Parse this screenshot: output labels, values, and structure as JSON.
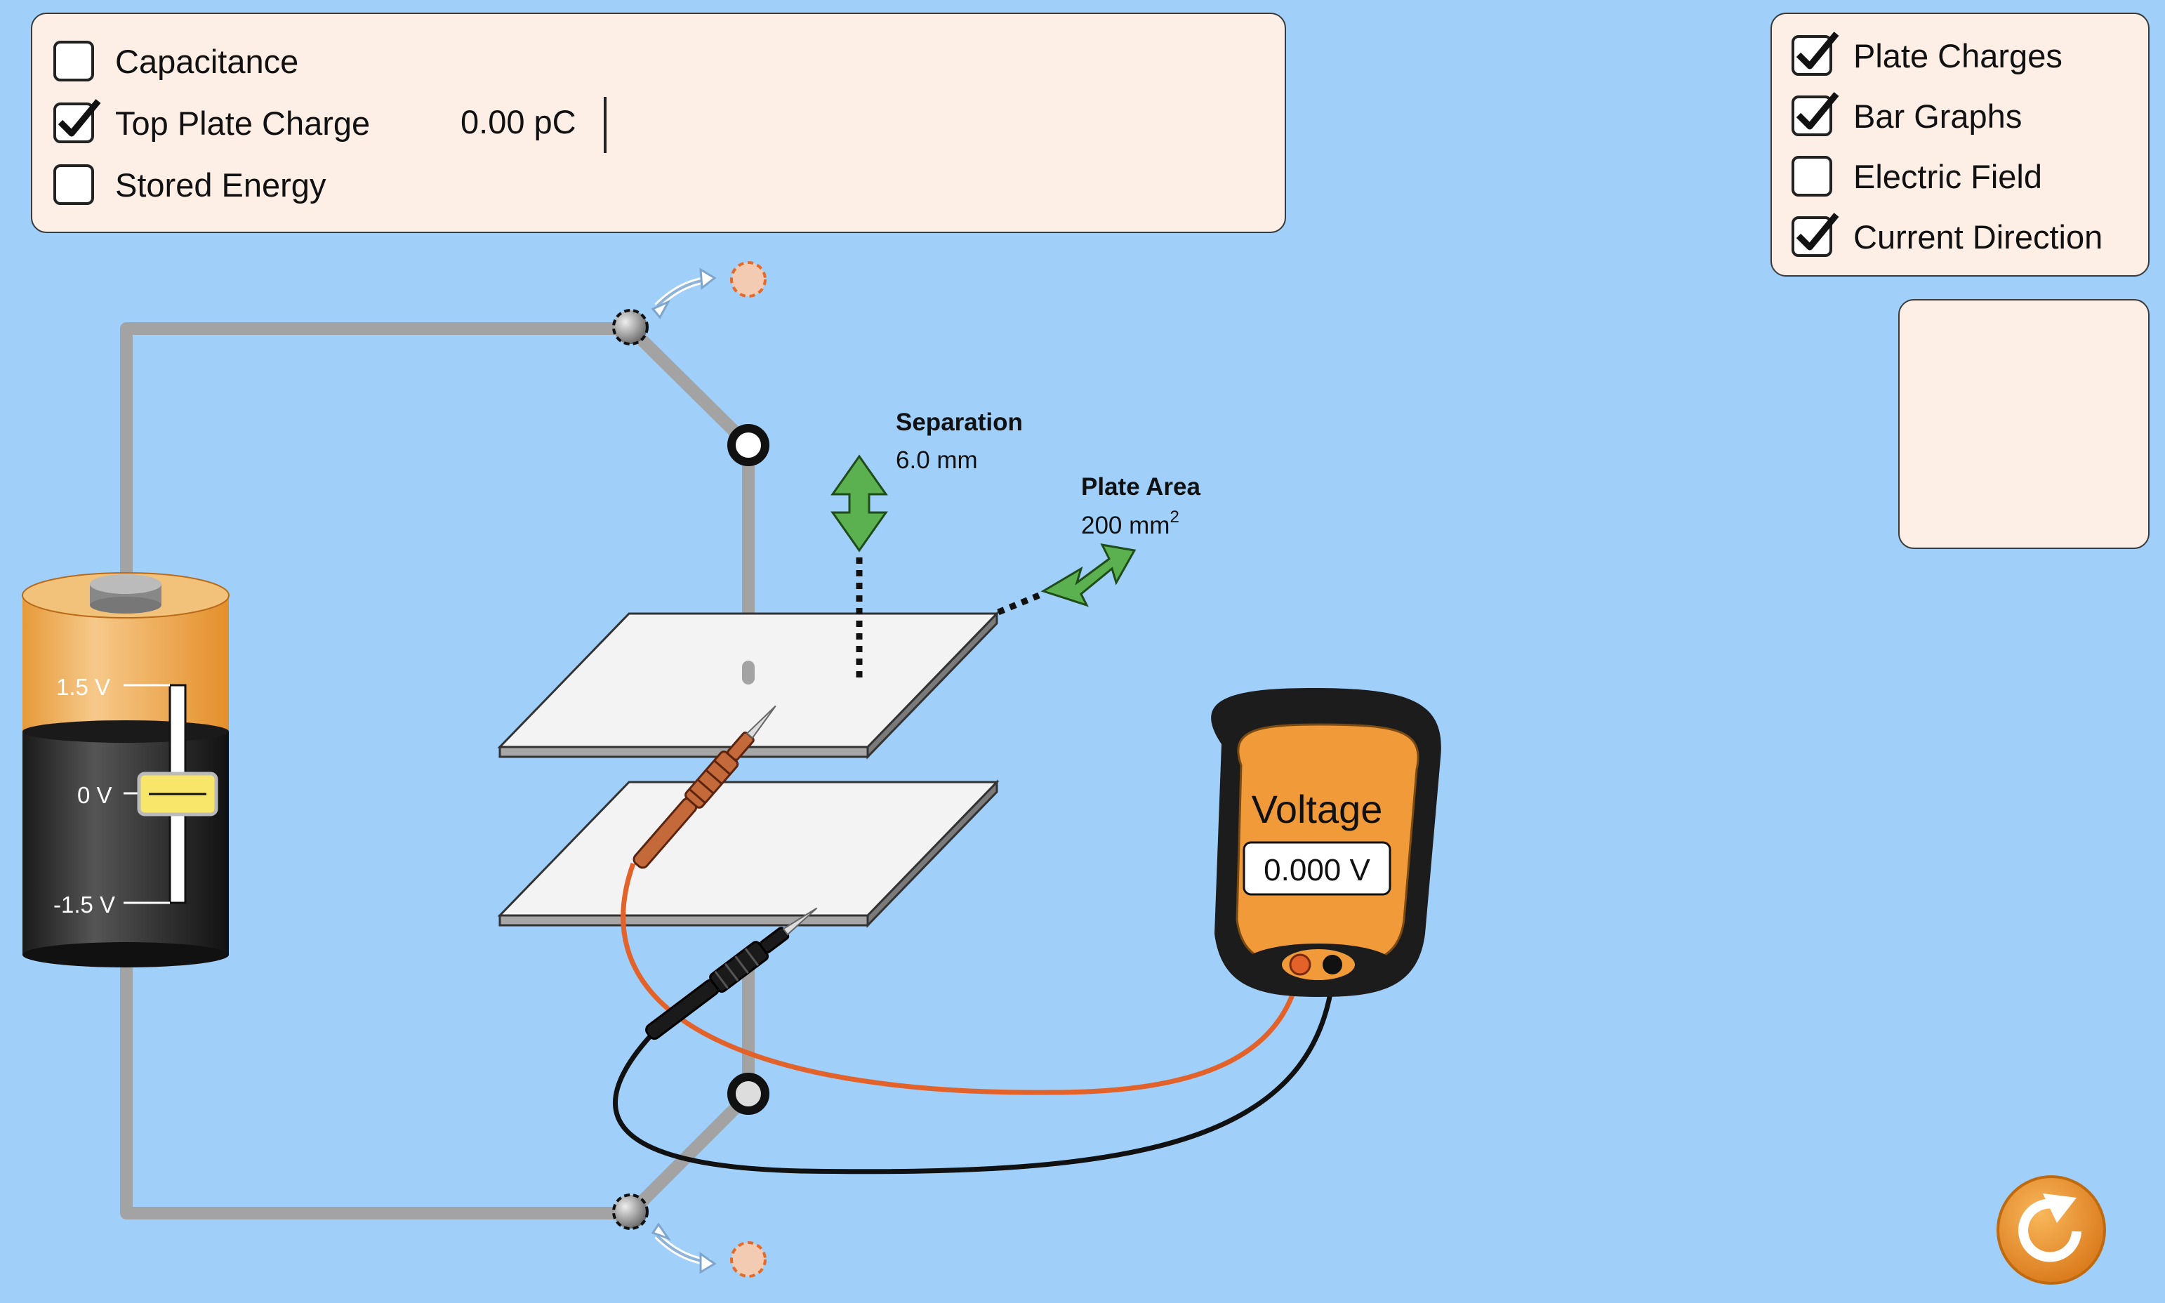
{
  "meters": {
    "capacitance": {
      "label": "Capacitance",
      "checked": false
    },
    "top_plate_charge": {
      "label": "Top Plate Charge",
      "checked": true,
      "value": "0.00 pC"
    },
    "stored_energy": {
      "label": "Stored Energy",
      "checked": false
    }
  },
  "view_options": {
    "plate_charges": {
      "label": "Plate Charges",
      "checked": true
    },
    "bar_graphs": {
      "label": "Bar Graphs",
      "checked": true
    },
    "electric_field": {
      "label": "Electric Field",
      "checked": false
    },
    "current_direction": {
      "label": "Current Direction",
      "checked": true
    }
  },
  "battery": {
    "label_top": "1.5 V",
    "label_mid": "0 V",
    "label_bottom": "-1.5 V",
    "voltage": 0
  },
  "separation": {
    "label": "Separation",
    "value": "6.0 mm"
  },
  "plate_area": {
    "label": "Plate Area",
    "value": "200 mm",
    "unit_sup": "2"
  },
  "voltmeter": {
    "title": "Voltage",
    "value": "0.000 V"
  },
  "icons": {
    "reset": "reset-icon",
    "check": "check-icon"
  },
  "colors": {
    "background": "#a0cffa",
    "panel": "#fdeee6",
    "arrow_green": "#5bb04f",
    "meter_orange": "#f09a3a",
    "probe_red": "#b5572e",
    "wire_gray": "#a3a3a3"
  }
}
